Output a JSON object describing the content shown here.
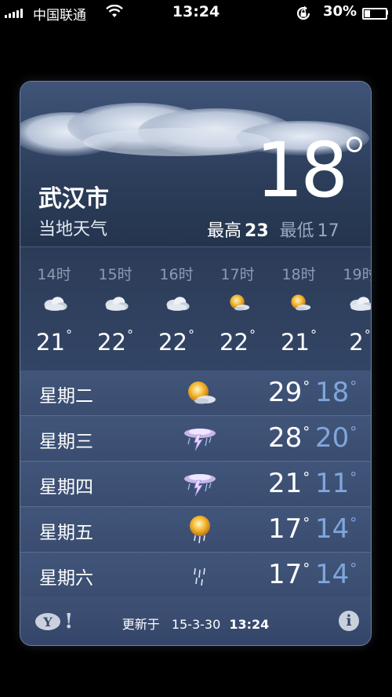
{
  "status_bar": {
    "carrier": "中国联通",
    "time": "13:24",
    "battery": "30%",
    "battery_level": 0.3,
    "icons": [
      "signal-icon",
      "wifi-icon",
      "rotation-lock-icon",
      "battery-icon"
    ]
  },
  "weather": {
    "city": "武汉市",
    "subtitle": "当地天气",
    "current_temp": "18",
    "high_label": "最高",
    "high": "23",
    "low_label": "最低",
    "low": "17"
  },
  "hourly": [
    {
      "time": "14时",
      "icon": "cloudy-icon",
      "temp": "21"
    },
    {
      "time": "15时",
      "icon": "cloudy-icon",
      "temp": "22"
    },
    {
      "time": "16时",
      "icon": "cloudy-icon",
      "temp": "22"
    },
    {
      "time": "17时",
      "icon": "partly-sunny-icon",
      "temp": "22"
    },
    {
      "time": "18时",
      "icon": "partly-sunny-icon",
      "temp": "21"
    },
    {
      "time": "19时",
      "icon": "cloudy-icon",
      "temp": "2"
    }
  ],
  "daily": [
    {
      "day": "星期二",
      "icon": "partly-sunny-icon",
      "high": "29",
      "low": "18"
    },
    {
      "day": "星期三",
      "icon": "thunderstorm-icon",
      "high": "28",
      "low": "20"
    },
    {
      "day": "星期四",
      "icon": "thunderstorm-icon",
      "high": "21",
      "low": "11"
    },
    {
      "day": "星期五",
      "icon": "sun-rain-icon",
      "high": "17",
      "low": "14"
    },
    {
      "day": "星期六",
      "icon": "rain-icon",
      "high": "17",
      "low": "14"
    }
  ],
  "footer": {
    "updated_label": "更新于",
    "updated_date": "15-3-30",
    "updated_time": "13:24",
    "yahoo_icon": "yahoo-logo-icon",
    "info_icon": "info-icon"
  },
  "colors": {
    "background": "#000000",
    "card": "#2b3b56",
    "low_temp": "#7fa6dc",
    "muted": "#8e9bb3"
  }
}
